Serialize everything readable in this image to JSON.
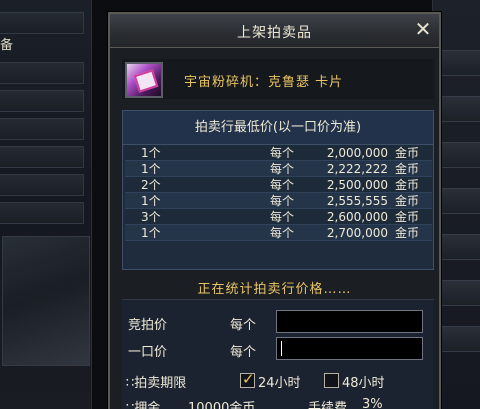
{
  "background": {
    "left_label": "备"
  },
  "window": {
    "title": "上架拍卖品",
    "close_glyph": "✕"
  },
  "item": {
    "name": "宇宙粉碎机：克鲁瑟 卡片",
    "icon": "item-card-icon"
  },
  "price_list": {
    "header": "拍卖行最低价(以一口价为准)",
    "rows": [
      {
        "qty": "1个",
        "each": "每个",
        "price": "2,000,000",
        "unit": "金币"
      },
      {
        "qty": "1个",
        "each": "每个",
        "price": "2,222,222",
        "unit": "金币"
      },
      {
        "qty": "2个",
        "each": "每个",
        "price": "2,500,000",
        "unit": "金币"
      },
      {
        "qty": "1个",
        "each": "每个",
        "price": "2,555,555",
        "unit": "金币"
      },
      {
        "qty": "3个",
        "each": "每个",
        "price": "2,600,000",
        "unit": "金币"
      },
      {
        "qty": "1个",
        "each": "每个",
        "price": "2,700,000",
        "unit": "金币"
      }
    ]
  },
  "status_text": "正在统计拍卖行价格……",
  "form": {
    "bid_label": "竞拍价",
    "buyout_label": "一口价",
    "each_label": "每个",
    "bid_value": "",
    "buyout_value": "",
    "period_label": "∷拍卖期限",
    "option_24": "24小时",
    "option_48": "48小时",
    "option_24_checked": true,
    "option_48_checked": false,
    "deposit_label": "∷押金",
    "deposit_value": "10000金币",
    "fee_label": "手续费",
    "fee_value": "3%"
  },
  "colors": {
    "accent_gold": "#e9c463",
    "panel_blue": "#1f2c3d"
  }
}
